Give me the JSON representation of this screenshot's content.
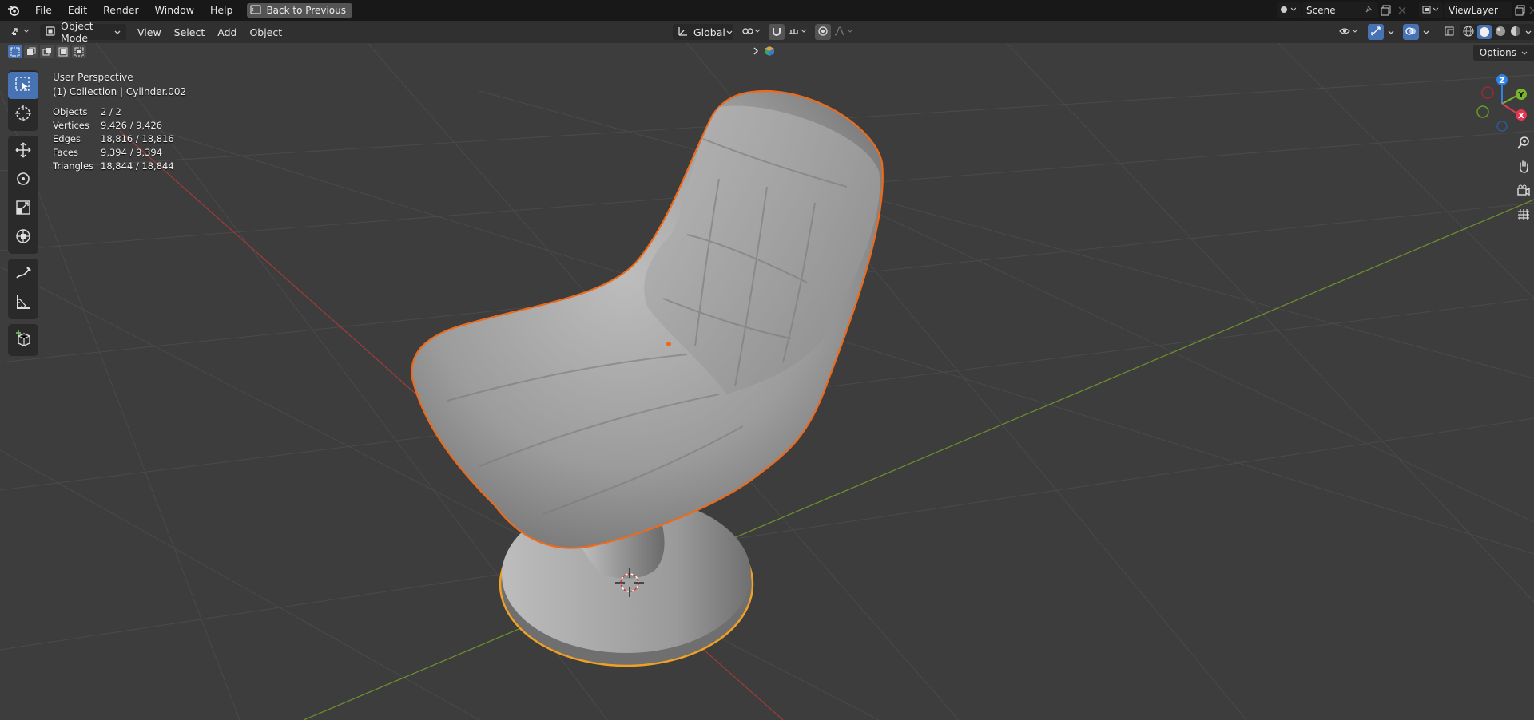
{
  "menu": {
    "file": "File",
    "edit": "Edit",
    "render": "Render",
    "window": "Window",
    "help": "Help",
    "back_to_previous": "Back to Previous"
  },
  "topright": {
    "scene_name": "Scene",
    "view_layer": "ViewLayer"
  },
  "header": {
    "mode": "Object Mode",
    "view": "View",
    "select": "Select",
    "add": "Add",
    "object": "Object",
    "transform_orientation": "Global",
    "options": "Options"
  },
  "overlay": {
    "view_name": "User Perspective",
    "collection_info": "(1) Collection | Cylinder.002"
  },
  "stats": [
    {
      "label": "Objects",
      "value": "2 / 2"
    },
    {
      "label": "Vertices",
      "value": "9,426 / 9,426"
    },
    {
      "label": "Edges",
      "value": "18,816 / 18,816"
    },
    {
      "label": "Faces",
      "value": "9,394 / 9,394"
    },
    {
      "label": "Triangles",
      "value": "18,844 / 18,844"
    }
  ],
  "gizmo": {
    "z_label": "Z",
    "y_label": "Y",
    "x_label": "X",
    "colors": {
      "x": "#e5374f",
      "y": "#7bb52c",
      "z": "#2f83e5"
    }
  },
  "colors": {
    "accent": "#4772b3",
    "selection_outline": "#f0780a",
    "background": "#3d3d3d"
  },
  "icons": [
    "blender-logo-icon",
    "select-box-icon",
    "cursor-icon",
    "move-icon",
    "rotate-icon",
    "scale-icon",
    "transform-icon",
    "annotate-icon",
    "measure-icon",
    "add-cube-icon",
    "zoom-icon",
    "pan-hand-icon",
    "camera-icon",
    "grid-icon"
  ]
}
